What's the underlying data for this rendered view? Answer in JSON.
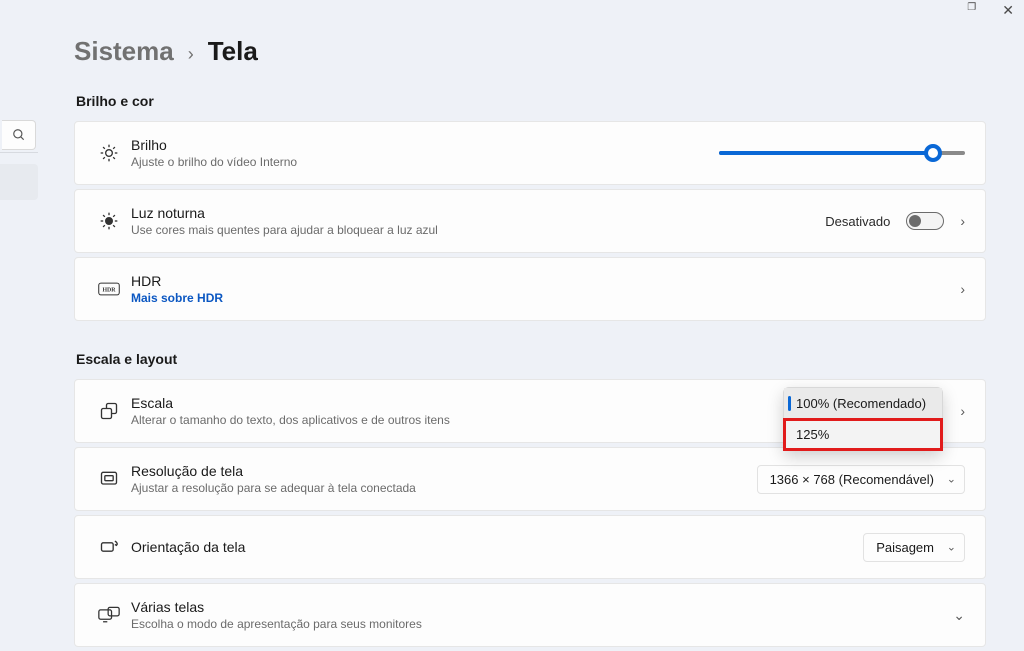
{
  "breadcrumb": {
    "parent": "Sistema",
    "current": "Tela"
  },
  "sections": {
    "brightness": {
      "header": "Brilho e cor",
      "brightness": {
        "title": "Brilho",
        "sub": "Ajuste o brilho do vídeo Interno"
      },
      "nightlight": {
        "title": "Luz noturna",
        "sub": "Use cores mais quentes para ajudar a bloquear a luz azul",
        "state_label": "Desativado"
      },
      "hdr": {
        "title": "HDR",
        "link": "Mais sobre HDR"
      }
    },
    "scale": {
      "header": "Escala e layout",
      "scale": {
        "title": "Escala",
        "sub": "Alterar o tamanho do texto, dos aplicativos e de outros itens",
        "options": [
          {
            "label": "100% (Recomendado)",
            "selected": true
          },
          {
            "label": "125%",
            "highlighted": true
          }
        ]
      },
      "resolution": {
        "title": "Resolução de tela",
        "sub": "Ajustar a resolução para se adequar à tela conectada",
        "value": "1366 × 768 (Recomendável)"
      },
      "orientation": {
        "title": "Orientação da tela",
        "value": "Paisagem"
      },
      "multiple": {
        "title": "Várias telas",
        "sub": "Escolha o modo de apresentação para seus monitores"
      }
    }
  }
}
